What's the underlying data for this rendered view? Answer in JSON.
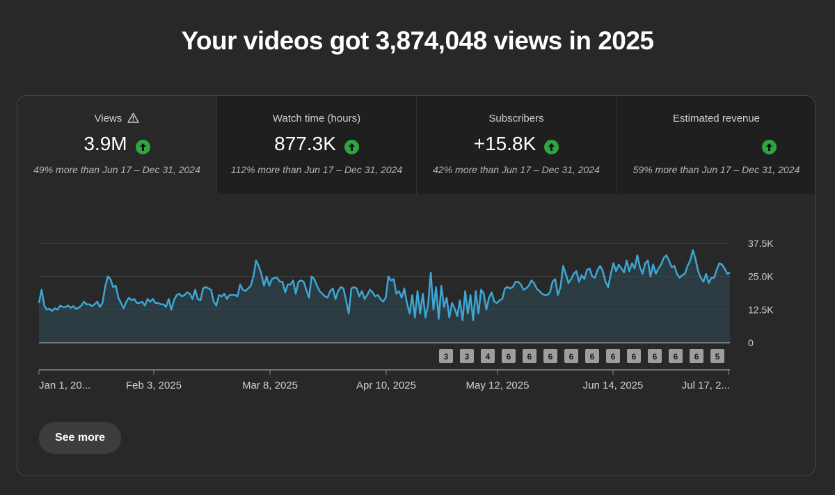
{
  "headline": "Your videos got 3,874,048 views in 2025",
  "colors": {
    "accent_line": "#3ea6d3",
    "up_badge": "#2ba640",
    "background": "#282828"
  },
  "tabs": [
    {
      "title": "Views",
      "title_icon": "warning-icon",
      "value": "3.9M",
      "trend_icon": "arrow-up-icon",
      "compare": "49% more than Jun 17 – Dec 31, 2024",
      "active": true
    },
    {
      "title": "Watch time (hours)",
      "value": "877.3K",
      "trend_icon": "arrow-up-icon",
      "compare": "112% more than Jun 17 – Dec 31, 2024"
    },
    {
      "title": "Subscribers",
      "value": "+15.8K",
      "trend_icon": "arrow-up-icon",
      "compare": "42% more than Jun 17 – Dec 31, 2024"
    },
    {
      "title": "Estimated revenue",
      "value": "",
      "trend_icon": "arrow-up-icon",
      "compare": "59% more than Jun 17 – Dec 31, 2024"
    }
  ],
  "chart_data": {
    "type": "area",
    "series": [
      {
        "values": [
          15000,
          20000,
          14000,
          12500,
          12800,
          12000,
          13000,
          12500,
          14000,
          13500,
          13500,
          14000,
          13200,
          13800,
          12800,
          13200,
          14000,
          15500,
          14500,
          14500,
          13800,
          14500,
          15500,
          13500,
          15000,
          21000,
          25000,
          24000,
          21000,
          21500,
          17000,
          15000,
          13000,
          15500,
          17000,
          16000,
          16500,
          15000,
          15000,
          15500,
          14000,
          16500,
          15500,
          16500,
          15000,
          15000,
          14500,
          14500,
          13500,
          16500,
          12500,
          16000,
          18000,
          18500,
          17500,
          18000,
          19000,
          18500,
          16500,
          20000,
          16500,
          16000,
          20500,
          21000,
          20500,
          20000,
          15500,
          14000,
          18000,
          17500,
          18500,
          16500,
          18000,
          18000,
          18000,
          17500,
          22000,
          20000,
          19500,
          20500,
          21500,
          25000,
          31000,
          29000,
          26000,
          21500,
          25000,
          21500,
          24000,
          24500,
          24500,
          23000,
          23000,
          19000,
          22000,
          22000,
          23500,
          18500,
          23000,
          23500,
          23000,
          20000,
          17000,
          25000,
          24000,
          21500,
          19500,
          18500,
          17500,
          17000,
          19500,
          20500,
          16500,
          19500,
          21000,
          20500,
          16000,
          11000,
          20500,
          21000,
          20500,
          17500,
          19500,
          16500,
          18000,
          20000,
          19000,
          17500,
          18000,
          16500,
          15500,
          17000,
          25000,
          23500,
          24000,
          18500,
          19500,
          17000,
          20500,
          15000,
          11000,
          18000,
          9500,
          19500,
          11000,
          18500,
          9500,
          14500,
          26500,
          12500,
          21000,
          9000,
          21500,
          13500,
          17000,
          9500,
          15000,
          13000,
          10000,
          16000,
          8500,
          19500,
          11000,
          18000,
          8500,
          19500,
          11000,
          20000,
          18500,
          12500,
          17000,
          19000,
          15500,
          15000,
          16000,
          16500,
          20500,
          21000,
          20500,
          21000,
          23000,
          23000,
          22000,
          20000,
          20500,
          21500,
          23500,
          22500,
          20500,
          19500,
          18500,
          18000,
          18000,
          19000,
          23000,
          24000,
          18000,
          21000,
          29000,
          26000,
          22500,
          24000,
          26000,
          27000,
          23000,
          25500,
          24000,
          27500,
          28000,
          25000,
          24500,
          27500,
          29000,
          27000,
          23000,
          21000,
          26000,
          30000,
          27000,
          29500,
          28000,
          26500,
          31000,
          27000,
          30000,
          28000,
          33000,
          28500,
          26000,
          30000,
          31000,
          25000,
          29500,
          26000,
          28000,
          29500,
          32000,
          33000,
          31000,
          28500,
          29000,
          26000,
          24500,
          25500,
          26000,
          29000,
          31000,
          35000,
          31500,
          27000,
          24500,
          23000,
          26000,
          22500,
          24500,
          24500,
          27500,
          30000,
          29500,
          28000,
          26000,
          26500
        ]
      }
    ],
    "ylim": [
      0,
      37500
    ],
    "yticks": [
      "0",
      "12.5K",
      "25.0K",
      "37.5K"
    ],
    "xticks": [
      "Jan 1, 20...",
      "Feb 3, 2025",
      "Mar 8, 2025",
      "Apr 10, 2025",
      "May 12, 2025",
      "Jun 14, 2025",
      "Jul 17, 2..."
    ],
    "markers": [
      "3",
      "3",
      "4",
      "6",
      "6",
      "6",
      "6",
      "6",
      "6",
      "6",
      "6",
      "6",
      "6",
      "5"
    ]
  },
  "see_more": "See more"
}
